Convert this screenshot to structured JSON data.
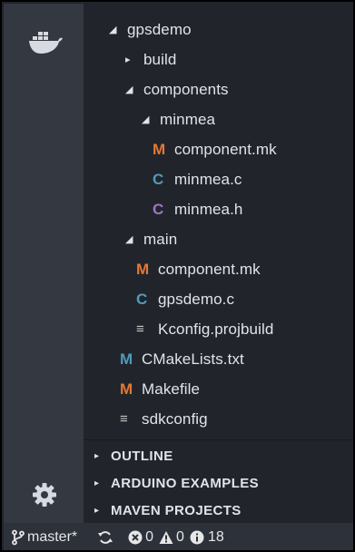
{
  "explorer": {
    "rows": [
      {
        "label": "gpsdemo",
        "twisty": "◢",
        "icon": "",
        "icon_class": ""
      },
      {
        "label": "build",
        "twisty": "▸",
        "icon": "",
        "icon_class": ""
      },
      {
        "label": "components",
        "twisty": "◢",
        "icon": "",
        "icon_class": ""
      },
      {
        "label": "minmea",
        "twisty": "◢",
        "icon": "",
        "icon_class": ""
      },
      {
        "label": "component.mk",
        "twisty": "",
        "icon": "M",
        "icon_class": "m-icon"
      },
      {
        "label": "minmea.c",
        "twisty": "",
        "icon": "C",
        "icon_class": "c-icon-blue"
      },
      {
        "label": "minmea.h",
        "twisty": "",
        "icon": "C",
        "icon_class": "c-icon-purple"
      },
      {
        "label": "main",
        "twisty": "◢",
        "icon": "",
        "icon_class": ""
      },
      {
        "label": "component.mk",
        "twisty": "",
        "icon": "M",
        "icon_class": "m-icon"
      },
      {
        "label": "gpsdemo.c",
        "twisty": "",
        "icon": "C",
        "icon_class": "c-icon-blue"
      },
      {
        "label": "Kconfig.projbuild",
        "twisty": "",
        "icon": "≡",
        "icon_class": "lines-icon"
      },
      {
        "label": "CMakeLists.txt",
        "twisty": "",
        "icon": "M",
        "icon_class": "cmake-icon"
      },
      {
        "label": "Makefile",
        "twisty": "",
        "icon": "M",
        "icon_class": "m-icon"
      },
      {
        "label": "sdkconfig",
        "twisty": "",
        "icon": "≡",
        "icon_class": "lines-icon"
      }
    ]
  },
  "panels": {
    "outline": "OUTLINE",
    "arduino": "ARDUINO EXAMPLES",
    "maven": "MAVEN PROJECTS",
    "twisty": "▸"
  },
  "statusbar": {
    "branch": "master*",
    "errors": "0",
    "warnings": "0",
    "infos": "18"
  },
  "colors": {
    "background": "#21252b",
    "activity_bar": "#333841",
    "status_bar": "#2c313a",
    "makefile_icon": "#e37933",
    "c_source_icon": "#519aba",
    "c_header_icon": "#a074c4"
  }
}
